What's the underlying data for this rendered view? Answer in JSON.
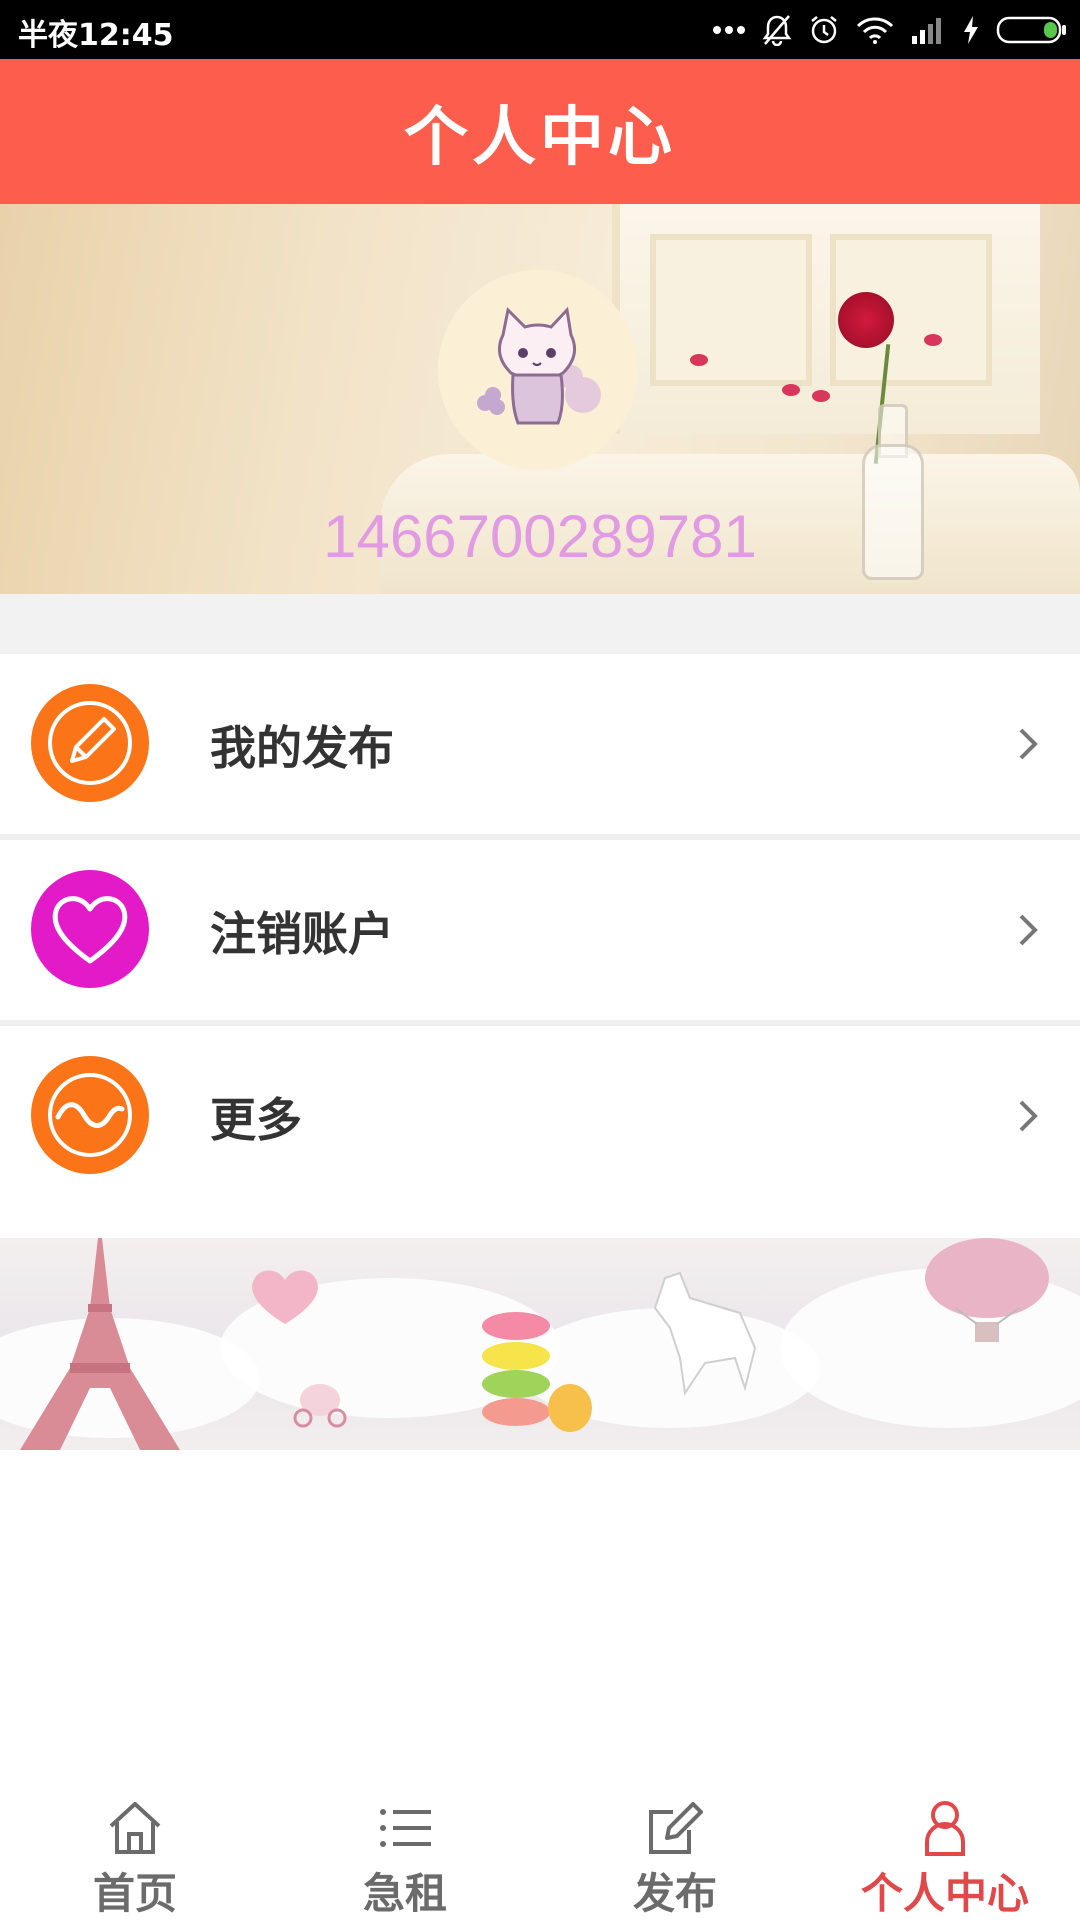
{
  "status_bar": {
    "time": "半夜12:45",
    "icons": [
      "more-dots-icon",
      "bell-off-icon",
      "alarm-icon",
      "wifi-icon",
      "signal-icon",
      "charging-icon",
      "battery-icon"
    ]
  },
  "header": {
    "title": "个人中心"
  },
  "profile": {
    "username": "14667002897​81"
  },
  "menu": [
    {
      "label": "我的发布",
      "icon": "pencil-icon",
      "color": "#fb7418"
    },
    {
      "label": "注销账户",
      "icon": "heart-icon",
      "color": "#e21ac8"
    },
    {
      "label": "更多",
      "icon": "wave-icon",
      "color": "#fb7418"
    }
  ],
  "tabbar": {
    "active_color": "#e0484a",
    "tabs": [
      {
        "label": "首页",
        "icon": "home-icon",
        "active": false
      },
      {
        "label": "急租",
        "icon": "list-icon",
        "active": false
      },
      {
        "label": "发布",
        "icon": "edit-icon",
        "active": false
      },
      {
        "label": "个人中心",
        "icon": "person-icon",
        "active": true
      }
    ]
  }
}
